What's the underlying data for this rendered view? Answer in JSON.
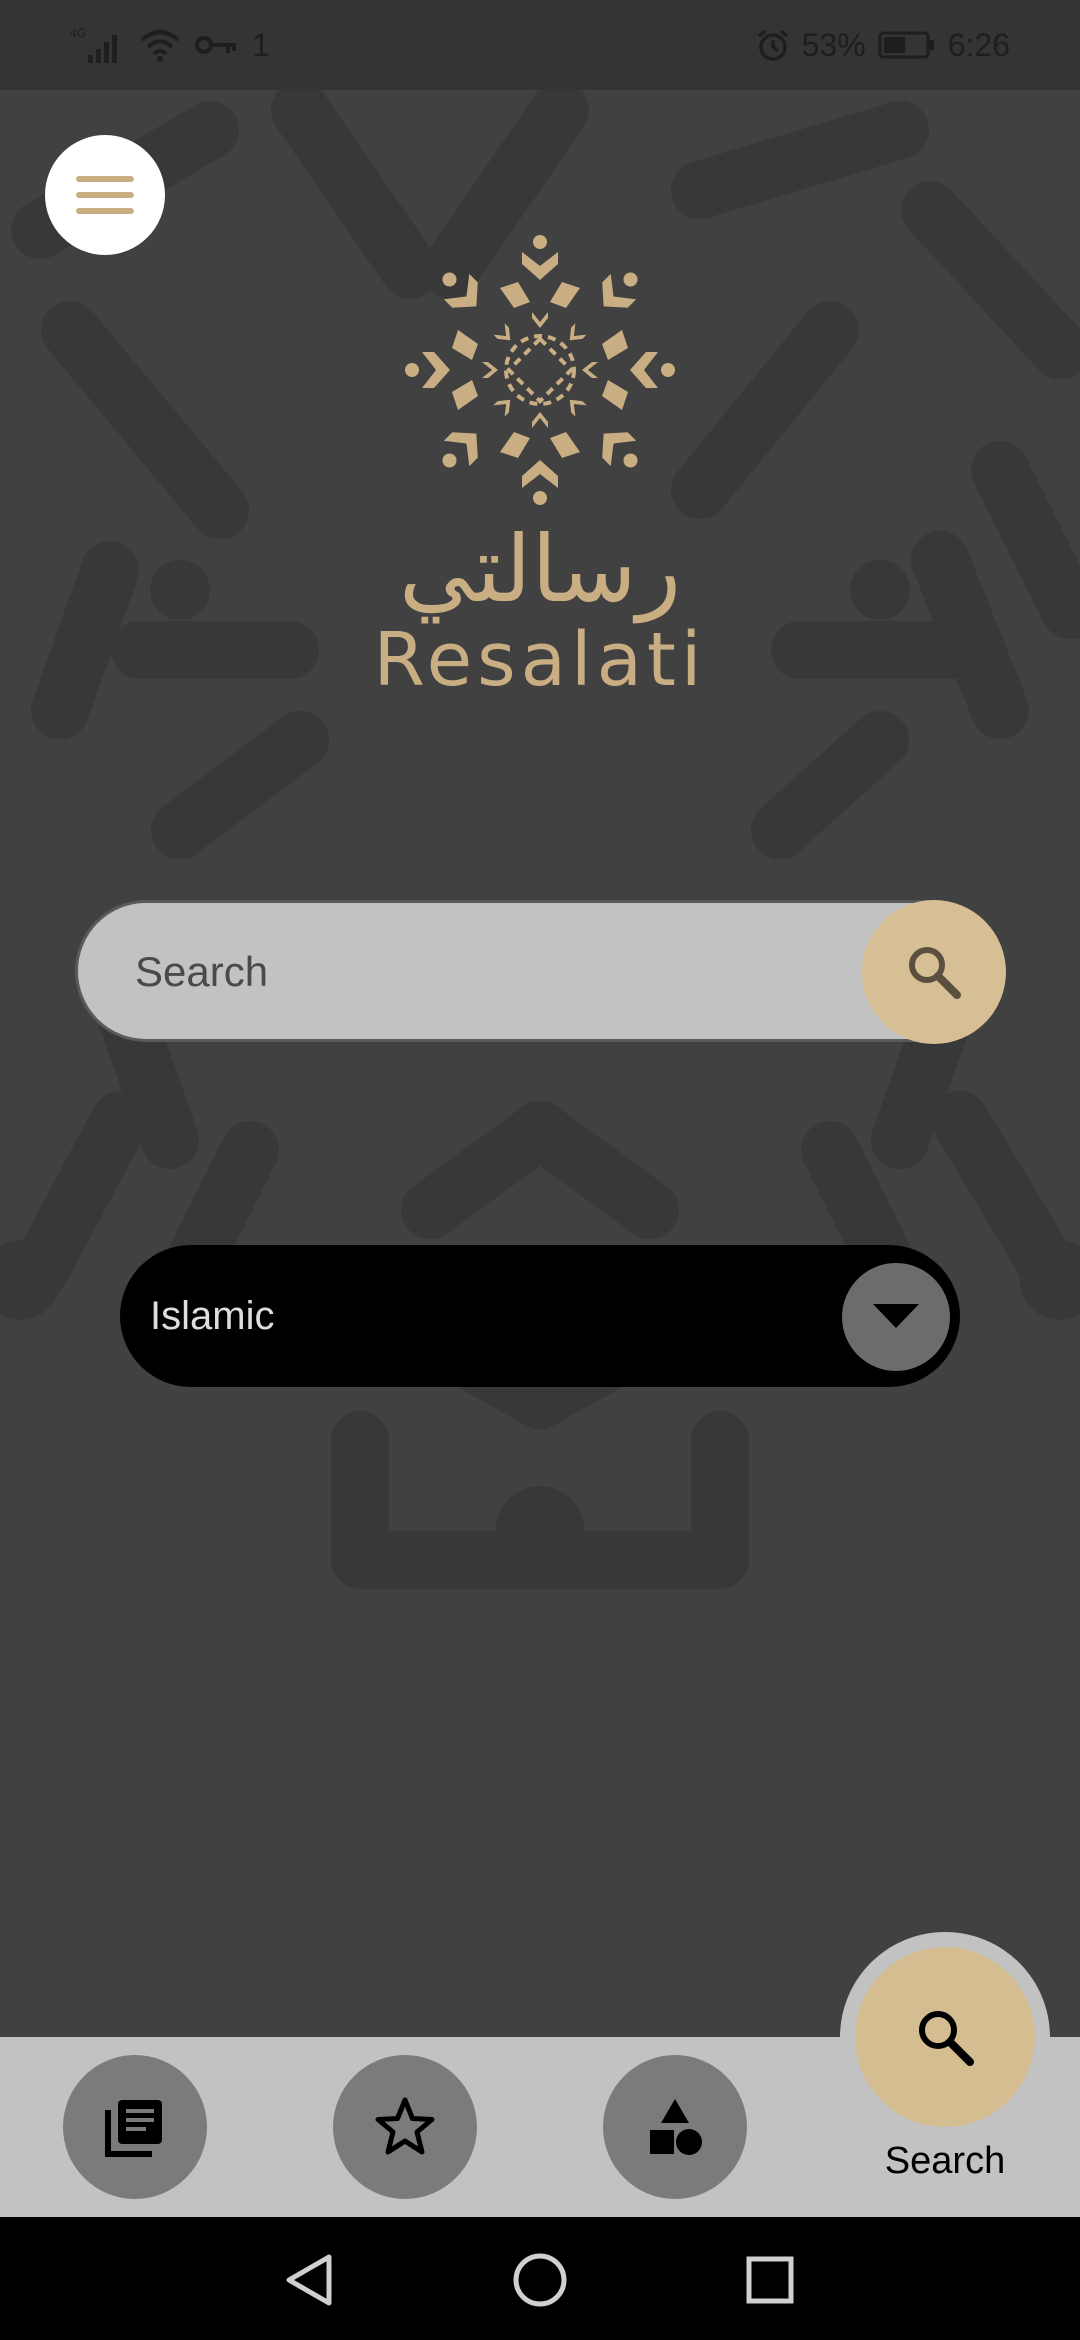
{
  "status_bar": {
    "network": "4G",
    "notification_count": "1",
    "battery_percent": "53%",
    "time": "6:26",
    "battery_level": 0.53
  },
  "app": {
    "logo_arabic": "رسالتي",
    "logo_latin": "Resalati",
    "accent_color": "#d7bf95"
  },
  "search": {
    "placeholder": "Search",
    "value": ""
  },
  "category": {
    "selected": "Islamic"
  },
  "bottom_nav": {
    "items": [
      {
        "icon": "library-icon"
      },
      {
        "icon": "star-icon"
      },
      {
        "icon": "shapes-icon"
      },
      {
        "icon": "search-icon",
        "label": "Search",
        "active": true
      }
    ]
  }
}
